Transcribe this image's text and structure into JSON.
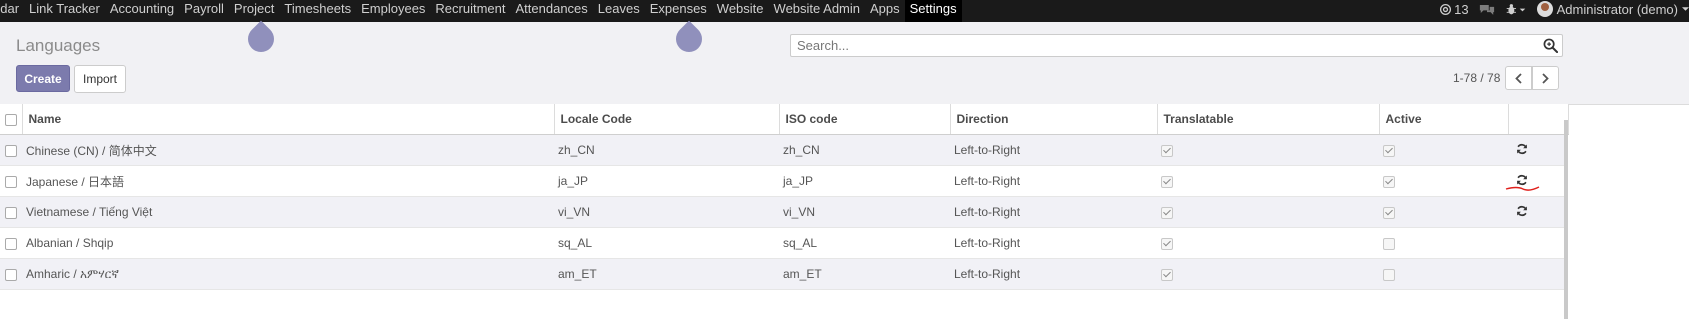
{
  "topbar": {
    "menu": [
      "ndar",
      "Link Tracker",
      "Accounting",
      "Payroll",
      "Project",
      "Timesheets",
      "Employees",
      "Recruitment",
      "Attendances",
      "Leaves",
      "Expenses",
      "Website",
      "Website Admin",
      "Apps",
      "Settings"
    ],
    "active": "Settings",
    "mention_count": "13",
    "user": "Administrator (demo)"
  },
  "control_panel": {
    "title": "Languages",
    "search_placeholder": "Search...",
    "create_label": "Create",
    "import_label": "Import",
    "pager": "1-78 / 78"
  },
  "table": {
    "headers": [
      "Name",
      "Locale Code",
      "ISO code",
      "Direction",
      "Translatable",
      "Active"
    ],
    "rows": [
      {
        "name": "Chinese (CN) / 简体中文",
        "locale": "zh_CN",
        "iso": "zh_CN",
        "direction": "Left-to-Right",
        "translatable": true,
        "active": true,
        "refresh": true
      },
      {
        "name": "Japanese / 日本語",
        "locale": "ja_JP",
        "iso": "ja_JP",
        "direction": "Left-to-Right",
        "translatable": true,
        "active": true,
        "refresh": true
      },
      {
        "name": "Vietnamese / Tiếng Việt",
        "locale": "vi_VN",
        "iso": "vi_VN",
        "direction": "Left-to-Right",
        "translatable": true,
        "active": true,
        "refresh": true
      },
      {
        "name": "Albanian / Shqip",
        "locale": "sq_AL",
        "iso": "sq_AL",
        "direction": "Left-to-Right",
        "translatable": true,
        "active": false,
        "refresh": false
      },
      {
        "name": "Amharic / አምሃርኛ",
        "locale": "am_ET",
        "iso": "am_ET",
        "direction": "Left-to-Right",
        "translatable": true,
        "active": false,
        "refresh": false
      }
    ]
  },
  "colors": {
    "primary": "#7c7bad",
    "topbar": "#1a1a1a",
    "row_alt": "#f1f1f6",
    "annotation": "#e0201c"
  }
}
